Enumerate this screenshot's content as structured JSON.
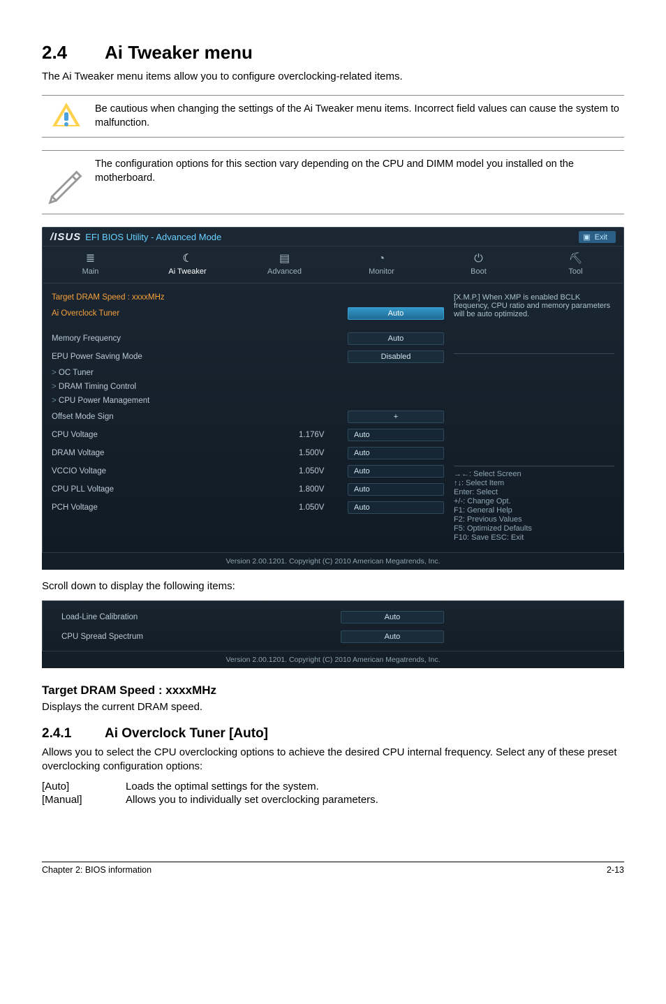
{
  "section": {
    "number": "2.4",
    "title": "Ai Tweaker menu"
  },
  "intro": "The Ai Tweaker menu items allow you to configure overclocking-related items.",
  "callout_warn": "Be cautious when changing the settings of the Ai Tweaker menu items. Incorrect field values can cause the system to malfunction.",
  "callout_note": "The configuration options for this section vary depending on the CPU and DIMM model you installed on the motherboard.",
  "bios": {
    "logo": "/ISUS",
    "title": "EFI BIOS Utility - Advanced Mode",
    "exit": "Exit",
    "tabs": {
      "main": "Main",
      "tweaker": "Ai  Tweaker",
      "advanced": "Advanced",
      "monitor": "Monitor",
      "boot": "Boot",
      "tool": "Tool"
    },
    "help_text": "[X.M.P.] When XMP is enabled BCLK frequency, CPU ratio and memory parameters will be auto optimized.",
    "keys": {
      "k1": "→←: Select Screen",
      "k2": "↑↓: Select Item",
      "k3": "Enter: Select",
      "k4": "+/-: Change Opt.",
      "k5": "F1: General Help",
      "k6": "F2: Previous Values",
      "k7": "F5: Optimized Defaults",
      "k8": "F10: Save   ESC: Exit"
    },
    "rows": {
      "target_dram": "Target DRAM Speed : xxxxMHz",
      "ai_oc_tuner": "Ai Overclock Tuner",
      "ai_oc_val": "Auto",
      "mem_freq": "Memory Frequency",
      "mem_freq_val": "Auto",
      "epu": "EPU Power Saving Mode",
      "epu_val": "Disabled",
      "oc_tuner": "OC Tuner",
      "dram_timing": "DRAM Timing Control",
      "cpu_pm": "CPU Power Management",
      "offset": "Offset Mode Sign",
      "offset_val": "+",
      "cpu_v": "CPU Voltage",
      "cpu_v_cur": "1.176V",
      "cpu_v_val": "Auto",
      "dram_v": "DRAM Voltage",
      "dram_v_cur": "1.500V",
      "dram_v_val": "Auto",
      "vccio": "VCCIO Voltage",
      "vccio_cur": "1.050V",
      "vccio_val": "Auto",
      "cpupll": "CPU PLL Voltage",
      "cpupll_cur": "1.800V",
      "cpupll_val": "Auto",
      "pch": "PCH Voltage",
      "pch_cur": "1.050V",
      "pch_val": "Auto"
    },
    "footer": "Version 2.00.1201.  Copyright (C) 2010 American Megatrends, Inc."
  },
  "scroll_text": "Scroll down to display the following items:",
  "bios2": {
    "llc": "Load-Line Calibration",
    "llc_val": "Auto",
    "css": "CPU Spread Spectrum",
    "css_val": "Auto",
    "footer": "Version 2.00.1201.  Copyright (C) 2010 American Megatrends, Inc."
  },
  "target_head": "Target DRAM Speed : xxxxMHz",
  "target_body": "Displays the current DRAM speed.",
  "sub241": {
    "num": "2.4.1",
    "title": "Ai Overclock Tuner [Auto]"
  },
  "sub241_body": "Allows you to select the CPU overclocking options to achieve the desired CPU internal frequency. Select any of these preset overclocking configuration options:",
  "opt_auto_k": "[Auto]",
  "opt_auto_v": "Loads the optimal settings for the system.",
  "opt_manual_k": "[Manual]",
  "opt_manual_v": "Allows you to individually set overclocking parameters.",
  "footer_left": "Chapter 2: BIOS information",
  "footer_right": "2-13"
}
